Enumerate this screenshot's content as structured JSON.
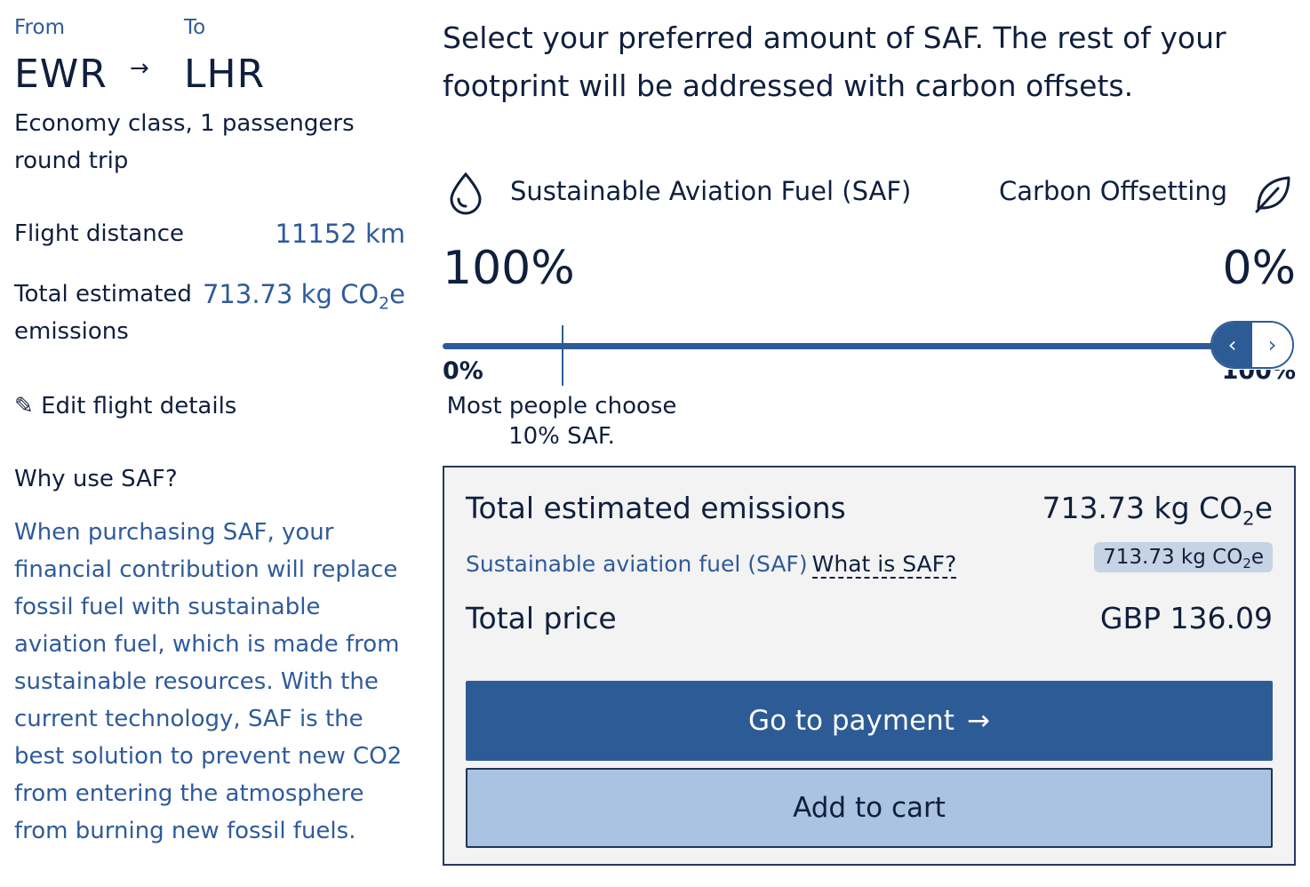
{
  "flight": {
    "from_label": "From",
    "to_label": "To",
    "from_code": "EWR",
    "to_code": "LHR",
    "arrow": "→",
    "class_info": "Economy class, 1 passengers round trip"
  },
  "stats": {
    "distance_label": "Flight distance",
    "distance_value": "11152 km",
    "emissions_label": "Total estimated emissions",
    "emissions_value_prefix": "713.73 kg CO",
    "emissions_value_sub": "2",
    "emissions_value_suffix": "e"
  },
  "edit": {
    "icon": "✎",
    "label": "Edit flight details"
  },
  "why": {
    "title": "Why use SAF?",
    "text": "When purchasing SAF, your financial contribution will replace fossil fuel with sustainable aviation fuel, which is made from sustainable resources. With the current technology, SAF is the best solution to prevent new CO2 from entering the atmosphere from burning new fossil fuels."
  },
  "selector": {
    "headline": "Select your preferred amount of SAF. The rest of your footprint will be addressed with carbon offsets.",
    "saf_label": "Sustainable Aviation Fuel (SAF)",
    "offset_label": "Carbon Offsetting",
    "saf_percent": "100%",
    "offset_percent": "0%",
    "slider_value_percent": 100,
    "marker_value_percent": 10,
    "tick_min": "0%",
    "tick_max": "100%",
    "hint_line1": "Most people choose",
    "hint_line2": "10% SAF.",
    "handle_left_icon": "‹",
    "handle_right_icon": "›"
  },
  "summary": {
    "emissions_label": "Total estimated emissions",
    "emissions_prefix": "713.73 kg CO",
    "emissions_sub": "2",
    "emissions_suffix": "e",
    "saf_label": "Sustainable aviation fuel (SAF)",
    "saf_link": "What is SAF?",
    "saf_prefix": "713.73 kg CO",
    "saf_sub": "2",
    "saf_suffix": "e",
    "price_label": "Total price",
    "price_value": "GBP 136.09"
  },
  "actions": {
    "pay_label": "Go to payment",
    "pay_arrow": "→",
    "cart_label": "Add to cart"
  },
  "colors": {
    "accent": "#2d5b96",
    "text_dark": "#0f1f3d",
    "link_blue": "#2f5b9a",
    "cart_bg": "#a9c3e0",
    "summary_bg": "#f3f3f3"
  },
  "icons": {
    "saf": "drop-icon",
    "offset": "leaf-icon",
    "edit": "pencil-icon"
  }
}
